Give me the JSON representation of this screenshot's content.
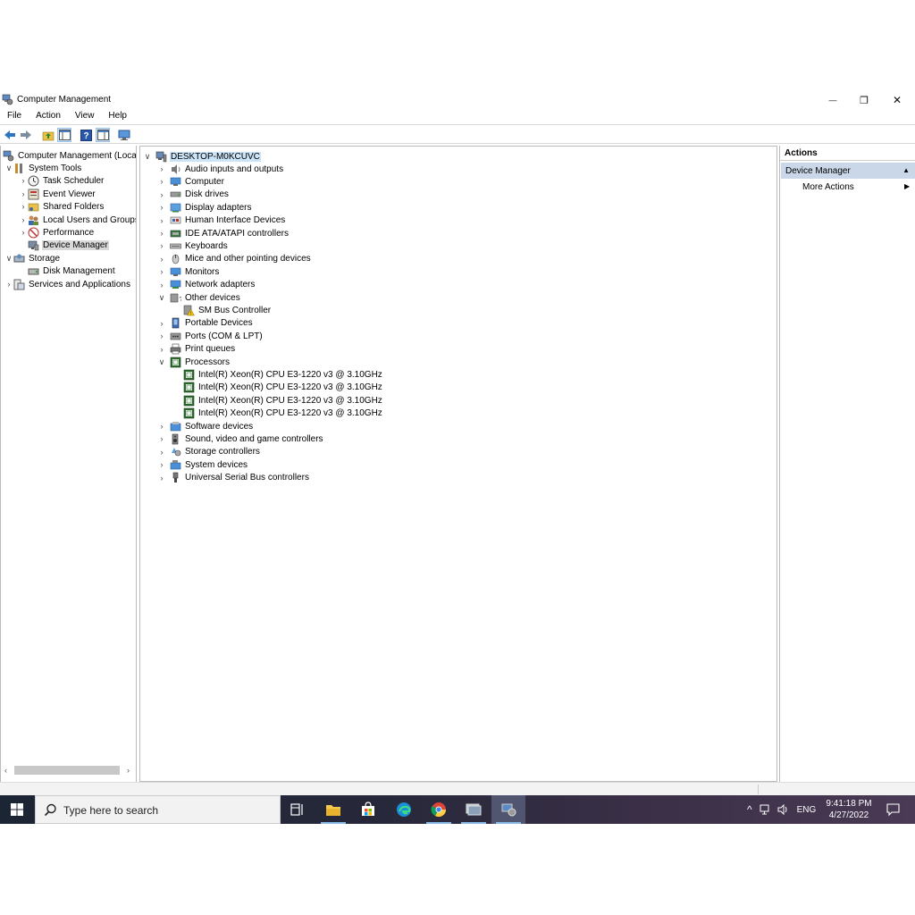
{
  "window": {
    "title": "Computer Management",
    "controls": {
      "minimize": "—",
      "maximize": "❐",
      "close": "✕"
    }
  },
  "menubar": {
    "items": [
      "File",
      "Action",
      "View",
      "Help"
    ]
  },
  "left_tree": {
    "root": "Computer Management (Local",
    "system_tools": "System Tools",
    "task_scheduler": "Task Scheduler",
    "event_viewer": "Event Viewer",
    "shared_folders": "Shared Folders",
    "local_users": "Local Users and Groups",
    "performance": "Performance",
    "device_manager": "Device Manager",
    "storage": "Storage",
    "disk_management": "Disk Management",
    "services": "Services and Applications"
  },
  "device_tree": {
    "computer_name": "DESKTOP-M0KCUVC",
    "audio": "Audio inputs and outputs",
    "computer": "Computer",
    "disk_drives": "Disk drives",
    "display_adapters": "Display adapters",
    "hid": "Human Interface Devices",
    "ide": "IDE ATA/ATAPI controllers",
    "keyboards": "Keyboards",
    "mice": "Mice and other pointing devices",
    "monitors": "Monitors",
    "network": "Network adapters",
    "other_devices": "Other devices",
    "sm_bus": "SM Bus Controller",
    "portable": "Portable Devices",
    "ports": "Ports (COM & LPT)",
    "print_queues": "Print queues",
    "processors": "Processors",
    "cpu": [
      "Intel(R) Xeon(R) CPU E3-1220 v3 @ 3.10GHz",
      "Intel(R) Xeon(R) CPU E3-1220 v3 @ 3.10GHz",
      "Intel(R) Xeon(R) CPU E3-1220 v3 @ 3.10GHz",
      "Intel(R) Xeon(R) CPU E3-1220 v3 @ 3.10GHz"
    ],
    "software_devices": "Software devices",
    "sound": "Sound, video and game controllers",
    "storage_controllers": "Storage controllers",
    "system_devices": "System devices",
    "usb": "Universal Serial Bus controllers"
  },
  "actions": {
    "header": "Actions",
    "section": "Device Manager",
    "more": "More Actions"
  },
  "taskbar": {
    "search_placeholder": "Type here to search",
    "language": "ENG",
    "time": "9:41:18 PM",
    "date": "4/27/2022"
  },
  "colors": {
    "selection": "#c9d7e8",
    "taskbar": "#26283a",
    "accent": "#0078d7"
  }
}
